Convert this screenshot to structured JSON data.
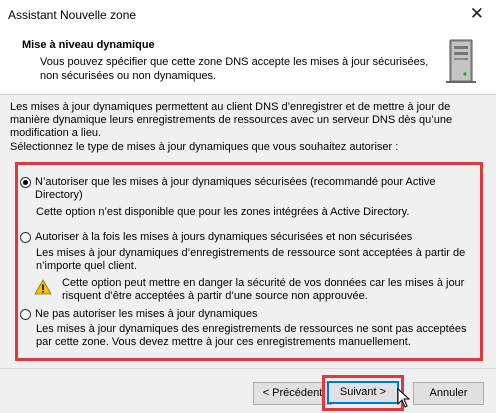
{
  "window": {
    "title": "Assistant Nouvelle zone",
    "close_glyph": "✕"
  },
  "header": {
    "title": "Mise à niveau dynamique",
    "description": "Vous pouvez spécifier que cette zone DNS accepte les mises à jour sécurisées, non sécurisées ou non dynamiques.",
    "icon": "server-icon"
  },
  "body": {
    "intro": "Les mises à jour dynamiques permettent au client DNS d’enregistrer et de mettre à jour de manière dynamique leurs enregistrements de ressources avec un serveur DNS dès qu’une modification a lieu.",
    "select_label": "Sélectionnez le type de mises à jour dynamiques que vous souhaitez autoriser :",
    "options": [
      {
        "label": "N’autoriser que les mises à jour dynamiques sécurisées (recommandé pour Active Directory)",
        "selected": true,
        "description": "Cette option n’est disponible que pour les zones intégrées à Active Directory."
      },
      {
        "label": "Autoriser à la fois les mises à jours dynamiques sécurisées et non sécurisées",
        "selected": false,
        "description": "Les mises à jour dynamiques d’enregistrements de ressource sont acceptées à partir de n’importe quel client.",
        "warning": "Cette option peut mettre en danger la sécurité de vos données car les mises à jour risquent d’être acceptées à partir d’une source non approuvée."
      },
      {
        "label": "Ne pas autoriser les mises à jour dynamiques",
        "selected": false,
        "description": "Les mises à jour dynamiques des enregistrements de ressources ne sont pas acceptées par cette zone. Vous devez mettre à jour ces enregistrements manuellement."
      }
    ]
  },
  "footer": {
    "back_label": "< Précédent",
    "next_label": "Suivant >",
    "cancel_label": "Annuler"
  },
  "colors": {
    "highlight_border": "#e0393f",
    "accent": "#0078d7"
  }
}
